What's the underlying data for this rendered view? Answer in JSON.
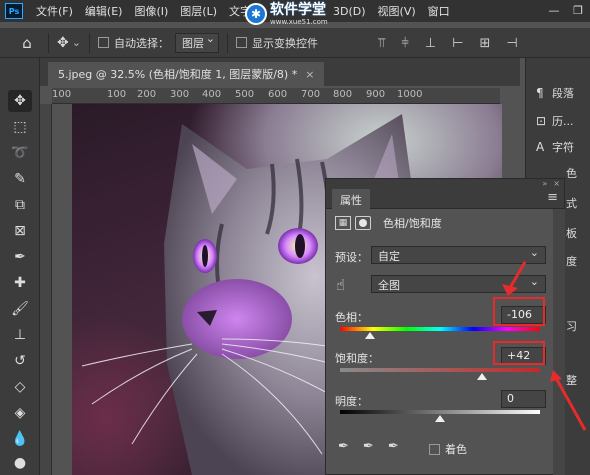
{
  "menu": {
    "app_logo": "Ps",
    "items": [
      "文件(F)",
      "编辑(E)",
      "图像(I)",
      "图层(L)",
      "文字",
      "3D(D)",
      "视图(V)",
      "窗口"
    ],
    "window_controls": [
      "—",
      "❐"
    ]
  },
  "watermark": {
    "logo_char": "✱",
    "title": "软件学堂",
    "url": "www.xue51.com"
  },
  "options": {
    "auto_select_label": "自动选择：",
    "auto_select_value": "图层",
    "show_transform_label": "显示变换控件"
  },
  "document_tab": {
    "title": "5.jpeg @ 32.5% (色相/饱和度 1, 图层蒙版/8) *",
    "close": "×"
  },
  "ruler": {
    "ticks": [
      "100",
      "100",
      "200",
      "300",
      "400",
      "500",
      "600",
      "700",
      "800",
      "900",
      "1000"
    ]
  },
  "dock": {
    "items": [
      {
        "icon": "¶",
        "label": "段落"
      },
      {
        "icon": "⊡",
        "label": "历..."
      },
      {
        "icon": "A",
        "label": "字符"
      }
    ],
    "side_strip": [
      "色",
      "式",
      "板",
      "度",
      "习",
      "整"
    ]
  },
  "properties": {
    "tab_label": "属性",
    "adjustment_title": "色相/饱和度",
    "preset_label": "预设：",
    "preset_value": "自定",
    "range_value": "全图",
    "hue": {
      "label": "色相：",
      "value": "-106",
      "fraction": 0.15
    },
    "saturation": {
      "label": "饱和度：",
      "value": "+42",
      "fraction": 0.71
    },
    "lightness": {
      "label": "明度：",
      "value": "0",
      "fraction": 0.5
    },
    "colorize_label": "着色"
  },
  "colors": {
    "annotation_red": "#e52b2b",
    "panel_bg": "#535353",
    "ui_dark": "#3c3c3c"
  }
}
